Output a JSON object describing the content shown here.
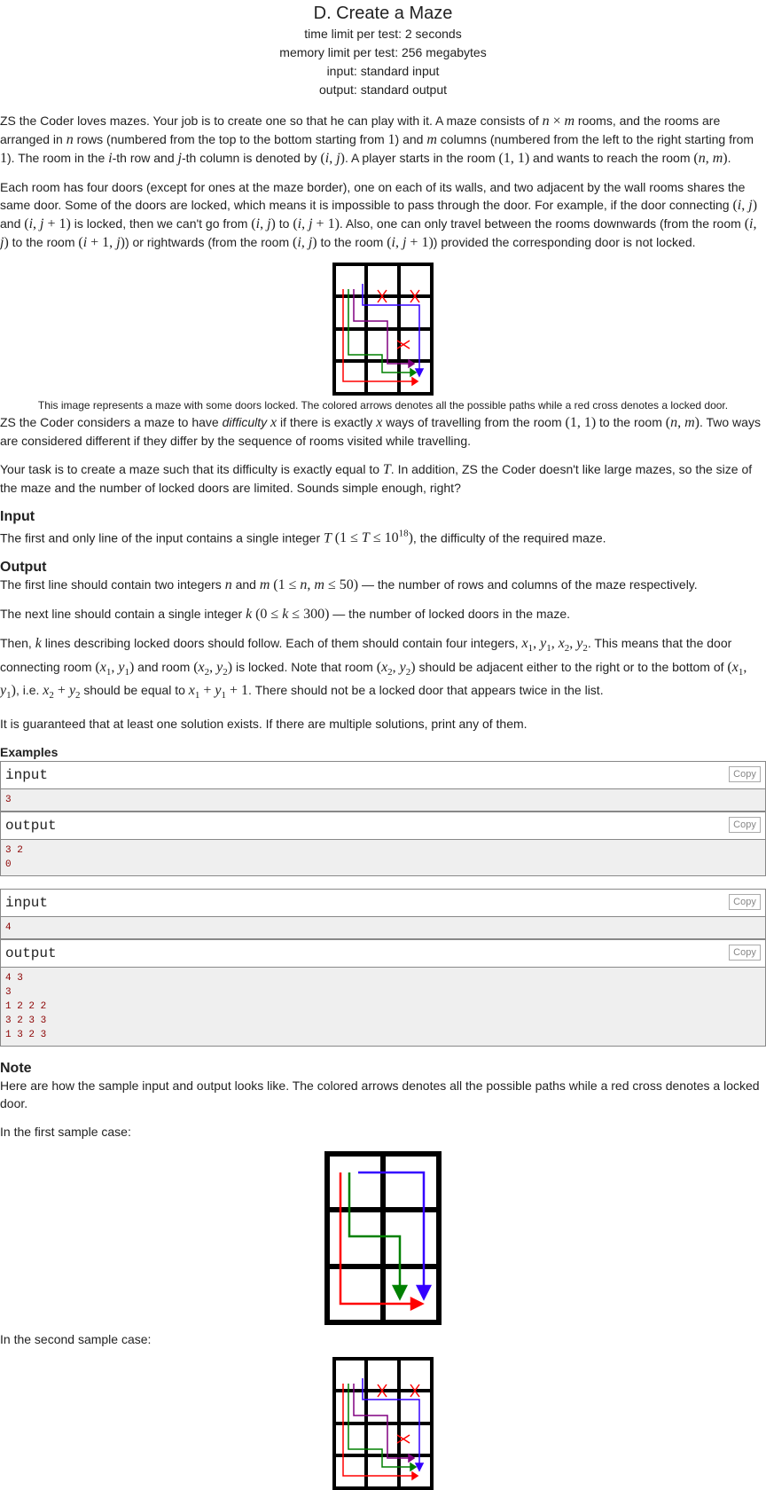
{
  "header": {
    "title": "D. Create a Maze",
    "time_limit": "time limit per test: 2 seconds",
    "memory_limit": "memory limit per test: 256 megabytes",
    "input": "input: standard input",
    "output": "output: standard output"
  },
  "figure_caption": "This image represents a maze with some doors locked. The colored arrows denotes all the possible paths while a red cross denotes a locked door.",
  "sections": {
    "input_title": "Input",
    "output_title": "Output",
    "examples_title": "Examples",
    "note_title": "Note",
    "note_text": "Here are how the sample input and output looks like. The colored arrows denotes all the possible paths while a red cross denotes a locked door.",
    "first_case": "In the first sample case:",
    "second_case": "In the second sample case:",
    "guarantee": "It is guaranteed that at least one solution exists. If there are multiple solutions, print any of them."
  },
  "samples": {
    "input_label": "input",
    "output_label": "output",
    "copy_label": "Copy",
    "s1_input": "3",
    "s1_output": "3 2\n0",
    "s2_input": "4",
    "s2_output": "4 3\n3\n1 2 2 2\n3 2 3 3\n1 3 2 3"
  },
  "colors": {
    "red": "#ff0000",
    "green": "#008000",
    "blue": "#3300ff",
    "purple": "#800080",
    "sample_text": "#8b0000"
  }
}
